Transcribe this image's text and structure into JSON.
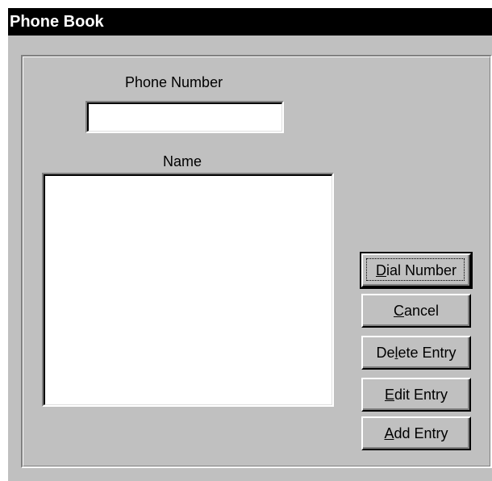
{
  "window": {
    "title": "Phone Book"
  },
  "form": {
    "phone_label": "Phone Number",
    "phone_value": "",
    "name_label": "Name",
    "name_list": []
  },
  "buttons": {
    "dial": {
      "mnemonic": "D",
      "rest": "ial Number"
    },
    "cancel": {
      "mnemonic": "C",
      "rest": "ancel"
    },
    "delete": {
      "pre": "De",
      "mnemonic": "l",
      "rest": "ete Entry"
    },
    "edit": {
      "mnemonic": "E",
      "rest": "dit Entry"
    },
    "add": {
      "mnemonic": "A",
      "rest": "dd Entry"
    }
  },
  "colors": {
    "face": "#c0c0c0",
    "titlebar": "#000000",
    "title_text": "#ffffff",
    "field_bg": "#ffffff"
  }
}
